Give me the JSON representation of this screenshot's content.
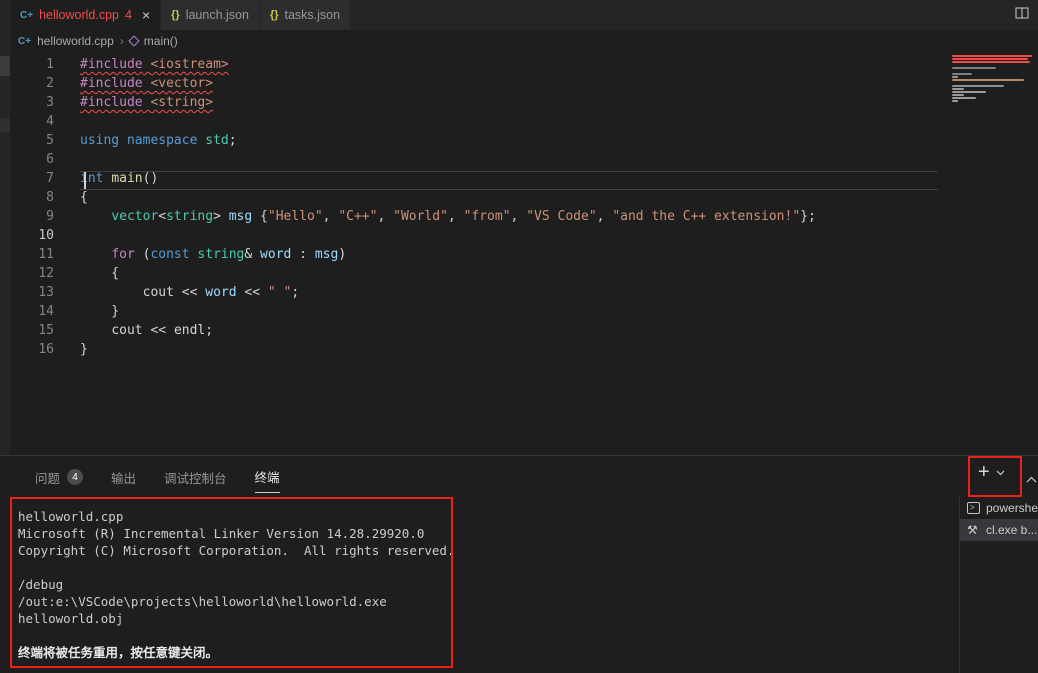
{
  "tab_bar": {
    "tabs": [
      {
        "label": "helloworld.cpp",
        "badge": "4",
        "close": "×"
      },
      {
        "label": "launch.json"
      },
      {
        "label": "tasks.json"
      }
    ],
    "icons": {
      "cpp": "C+",
      "json": "{}"
    }
  },
  "breadcrumb": {
    "file": "helloworld.cpp",
    "separator": "›",
    "symbol": "main()"
  },
  "editor": {
    "current_line": 10,
    "lines": [
      {
        "error": true,
        "tokens": [
          {
            "t": "#include",
            "c": "pp"
          },
          {
            "t": " ",
            "c": "pl"
          },
          {
            "t": "<iostream>",
            "c": "str"
          }
        ]
      },
      {
        "error": true,
        "tokens": [
          {
            "t": "#include",
            "c": "pp"
          },
          {
            "t": " ",
            "c": "pl"
          },
          {
            "t": "<vector>",
            "c": "str"
          }
        ]
      },
      {
        "error": true,
        "tokens": [
          {
            "t": "#include",
            "c": "pp"
          },
          {
            "t": " ",
            "c": "pl"
          },
          {
            "t": "<string>",
            "c": "str"
          }
        ]
      },
      {
        "error": false,
        "tokens": []
      },
      {
        "error": false,
        "tokens": [
          {
            "t": "using",
            "c": "kw"
          },
          {
            "t": " ",
            "c": "pl"
          },
          {
            "t": "namespace",
            "c": "kw"
          },
          {
            "t": " ",
            "c": "pl"
          },
          {
            "t": "std",
            "c": "type"
          },
          {
            "t": ";",
            "c": "pl"
          }
        ]
      },
      {
        "error": false,
        "tokens": []
      },
      {
        "error": false,
        "tokens": [
          {
            "t": "int",
            "c": "kw"
          },
          {
            "t": " ",
            "c": "pl"
          },
          {
            "t": "main",
            "c": "fn"
          },
          {
            "t": "()",
            "c": "pl"
          }
        ]
      },
      {
        "error": false,
        "tokens": [
          {
            "t": "{",
            "c": "pl"
          }
        ]
      },
      {
        "error": false,
        "tokens": [
          {
            "t": "    ",
            "c": "pl"
          },
          {
            "t": "vector",
            "c": "type"
          },
          {
            "t": "<",
            "c": "pl"
          },
          {
            "t": "string",
            "c": "type"
          },
          {
            "t": "> ",
            "c": "pl"
          },
          {
            "t": "msg",
            "c": "var"
          },
          {
            "t": " {",
            "c": "pl"
          },
          {
            "t": "\"Hello\"",
            "c": "str"
          },
          {
            "t": ", ",
            "c": "pl"
          },
          {
            "t": "\"C++\"",
            "c": "str"
          },
          {
            "t": ", ",
            "c": "pl"
          },
          {
            "t": "\"World\"",
            "c": "str"
          },
          {
            "t": ", ",
            "c": "pl"
          },
          {
            "t": "\"from\"",
            "c": "str"
          },
          {
            "t": ", ",
            "c": "pl"
          },
          {
            "t": "\"VS Code\"",
            "c": "str"
          },
          {
            "t": ", ",
            "c": "pl"
          },
          {
            "t": "\"and the C++ extension!\"",
            "c": "str"
          },
          {
            "t": "};",
            "c": "pl"
          }
        ]
      },
      {
        "error": false,
        "tokens": []
      },
      {
        "error": false,
        "tokens": [
          {
            "t": "    ",
            "c": "pl"
          },
          {
            "t": "for",
            "c": "ctrl"
          },
          {
            "t": " (",
            "c": "pl"
          },
          {
            "t": "const",
            "c": "kw"
          },
          {
            "t": " ",
            "c": "pl"
          },
          {
            "t": "string",
            "c": "type"
          },
          {
            "t": "& ",
            "c": "pl"
          },
          {
            "t": "word",
            "c": "var"
          },
          {
            "t": " : ",
            "c": "pl"
          },
          {
            "t": "msg",
            "c": "var"
          },
          {
            "t": ")",
            "c": "pl"
          }
        ]
      },
      {
        "error": false,
        "tokens": [
          {
            "t": "    {",
            "c": "pl"
          }
        ]
      },
      {
        "error": false,
        "tokens": [
          {
            "t": "        ",
            "c": "pl"
          },
          {
            "t": "cout",
            "c": "pl"
          },
          {
            "t": " << ",
            "c": "pl"
          },
          {
            "t": "word",
            "c": "var"
          },
          {
            "t": " << ",
            "c": "pl"
          },
          {
            "t": "\" \"",
            "c": "str"
          },
          {
            "t": ";",
            "c": "pl"
          }
        ]
      },
      {
        "error": false,
        "tokens": [
          {
            "t": "    }",
            "c": "pl"
          }
        ]
      },
      {
        "error": false,
        "tokens": [
          {
            "t": "    ",
            "c": "pl"
          },
          {
            "t": "cout",
            "c": "pl"
          },
          {
            "t": " << ",
            "c": "pl"
          },
          {
            "t": "endl",
            "c": "pl"
          },
          {
            "t": ";",
            "c": "pl"
          }
        ]
      },
      {
        "error": false,
        "tokens": [
          {
            "t": "}",
            "c": "pl"
          }
        ]
      }
    ]
  },
  "panel": {
    "tabs": [
      {
        "label": "问题",
        "badge": "4"
      },
      {
        "label": "输出"
      },
      {
        "label": "调试控制台"
      },
      {
        "label": "终端"
      }
    ],
    "active_tab": "终端",
    "new_terminal_label": "+",
    "terminal": {
      "lines": [
        {
          "text": "helloworld.cpp",
          "bold": false
        },
        {
          "text": "Microsoft (R) Incremental Linker Version 14.28.29920.0",
          "bold": false
        },
        {
          "text": "Copyright (C) Microsoft Corporation.  All rights reserved.",
          "bold": false
        },
        {
          "text": "",
          "bold": false
        },
        {
          "text": "/debug",
          "bold": false
        },
        {
          "text": "/out:e:\\VSCode\\projects\\helloworld\\helloworld.exe",
          "bold": false
        },
        {
          "text": "helloworld.obj",
          "bold": false
        },
        {
          "text": "",
          "bold": false
        },
        {
          "text": "终端将被任务重用，按任意键关闭。",
          "bold": true
        }
      ]
    },
    "terminal_list": [
      {
        "label": "powershell",
        "selected": false
      },
      {
        "label": "cl.exe b...",
        "selected": true
      }
    ]
  }
}
